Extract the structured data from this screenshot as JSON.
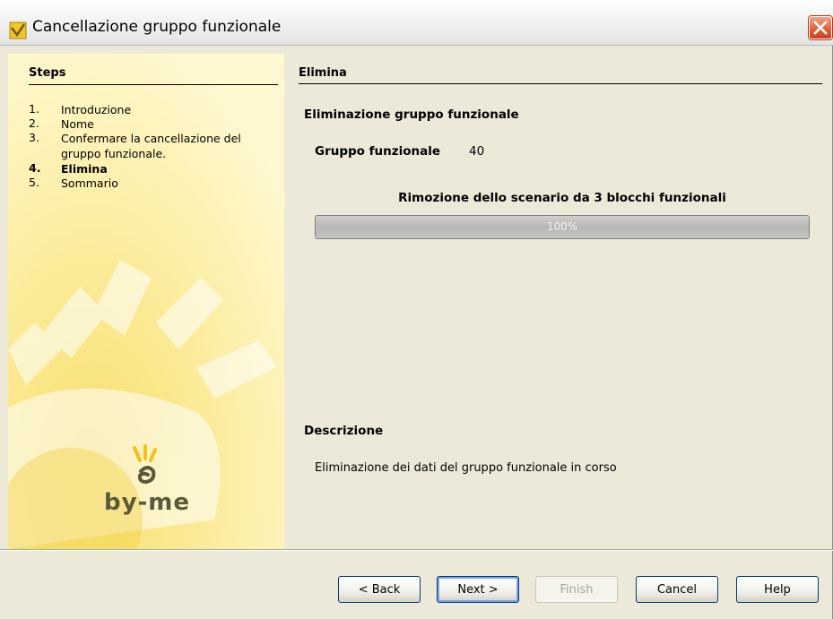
{
  "window": {
    "title": "Cancellazione gruppo funzionale"
  },
  "sidebar": {
    "heading": "Steps",
    "steps": [
      {
        "num": "1.",
        "label": "Introduzione"
      },
      {
        "num": "2.",
        "label": "Nome"
      },
      {
        "num": "3.",
        "label": "Confermare la cancellazione del gruppo funzionale."
      },
      {
        "num": "4.",
        "label": "Elimina"
      },
      {
        "num": "5.",
        "label": "Sommario"
      }
    ],
    "active_step": 4,
    "logo_text": "by-me"
  },
  "main": {
    "heading": "Elimina",
    "section_title": "Eliminazione gruppo funzionale",
    "field_label": "Gruppo funzionale",
    "field_value": "40",
    "progress_caption": "Rimozione dello scenario da 3 blocchi funzionali",
    "progress_text": "100%",
    "progress_fraction": 1.0,
    "description_title": "Descrizione",
    "description_text": "Eliminazione dei dati del gruppo funzionale in corso"
  },
  "buttons": {
    "back": "< Back",
    "next": "Next >",
    "finish": "Finish",
    "cancel": "Cancel",
    "help": "Help"
  },
  "colors": {
    "sidebar_bg": "#fff6c0",
    "dialog_bg": "#ece9d8",
    "close_button": "#e45a33"
  },
  "icons": {
    "app": "app-icon",
    "close": "close-icon"
  }
}
